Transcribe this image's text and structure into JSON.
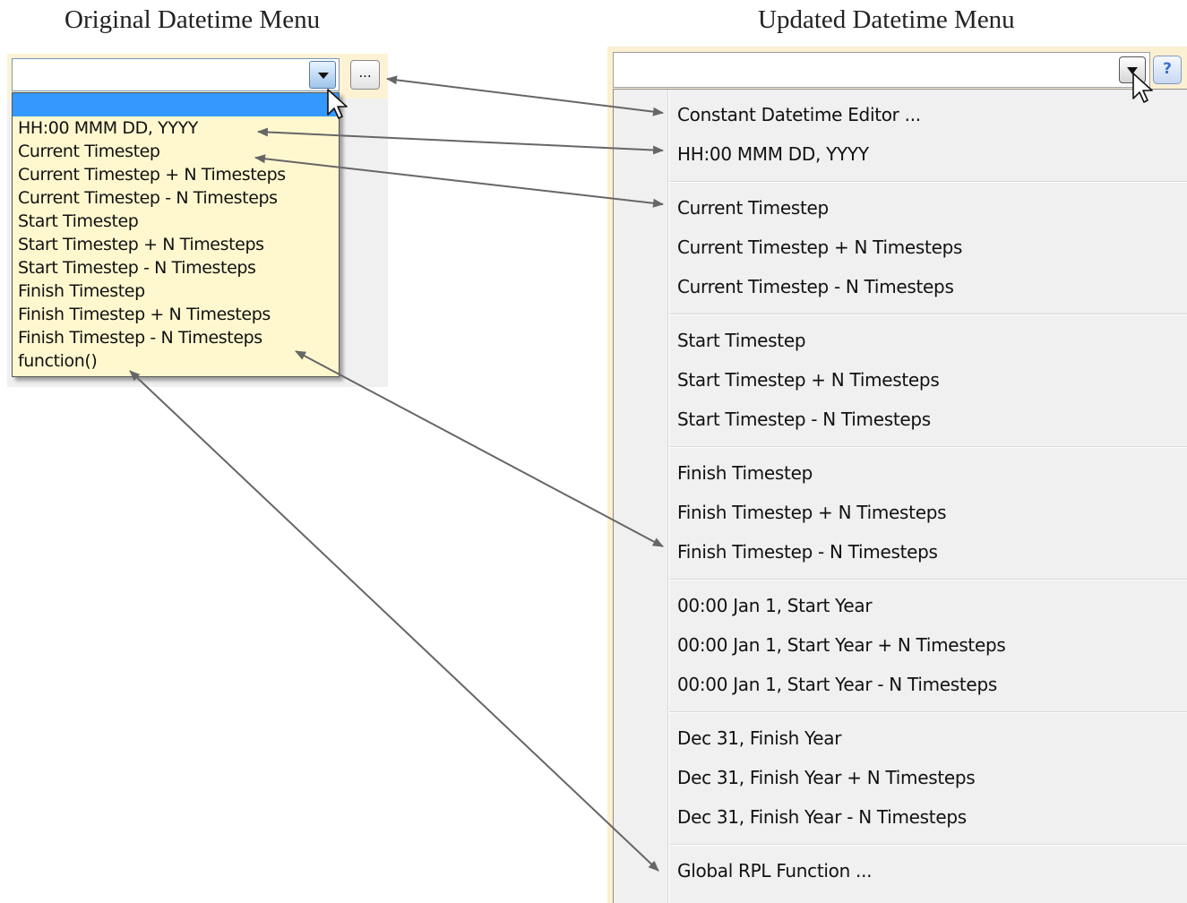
{
  "captions": {
    "left": "Original Datetime Menu",
    "right": "Updated Datetime Menu"
  },
  "original": {
    "ellipsis_label": "...",
    "items": [
      "HH:00 MMM DD, YYYY",
      "Current Timestep",
      "Current Timestep + N Timesteps",
      "Current Timestep - N Timesteps",
      "Start Timestep",
      "Start Timestep + N Timesteps",
      "Start Timestep - N Timesteps",
      "Finish Timestep",
      "Finish Timestep + N Timesteps",
      "Finish Timestep - N Timesteps",
      "function()"
    ]
  },
  "updated": {
    "help_label": "?",
    "groups": [
      [
        "Constant Datetime Editor ...",
        "HH:00 MMM DD, YYYY"
      ],
      [
        "Current Timestep",
        "Current Timestep + N Timesteps",
        "Current Timestep - N Timesteps"
      ],
      [
        "Start Timestep",
        "Start Timestep + N Timesteps",
        "Start Timestep - N Timesteps"
      ],
      [
        "Finish Timestep",
        "Finish Timestep + N Timesteps",
        "Finish Timestep - N Timesteps"
      ],
      [
        "00:00 Jan 1, Start Year",
        "00:00 Jan 1, Start Year + N Timesteps",
        "00:00 Jan 1, Start Year - N Timesteps"
      ],
      [
        "Dec 31, Finish Year",
        "Dec 31, Finish Year + N Timesteps",
        "Dec 31, Finish Year - N Timesteps"
      ],
      [
        "Global RPL Function ..."
      ]
    ]
  },
  "colors": {
    "selection": "#3399ff",
    "original_list_bg": "#fff8cf",
    "menu_bg": "#f0f0f0",
    "arrow": "#666666"
  }
}
